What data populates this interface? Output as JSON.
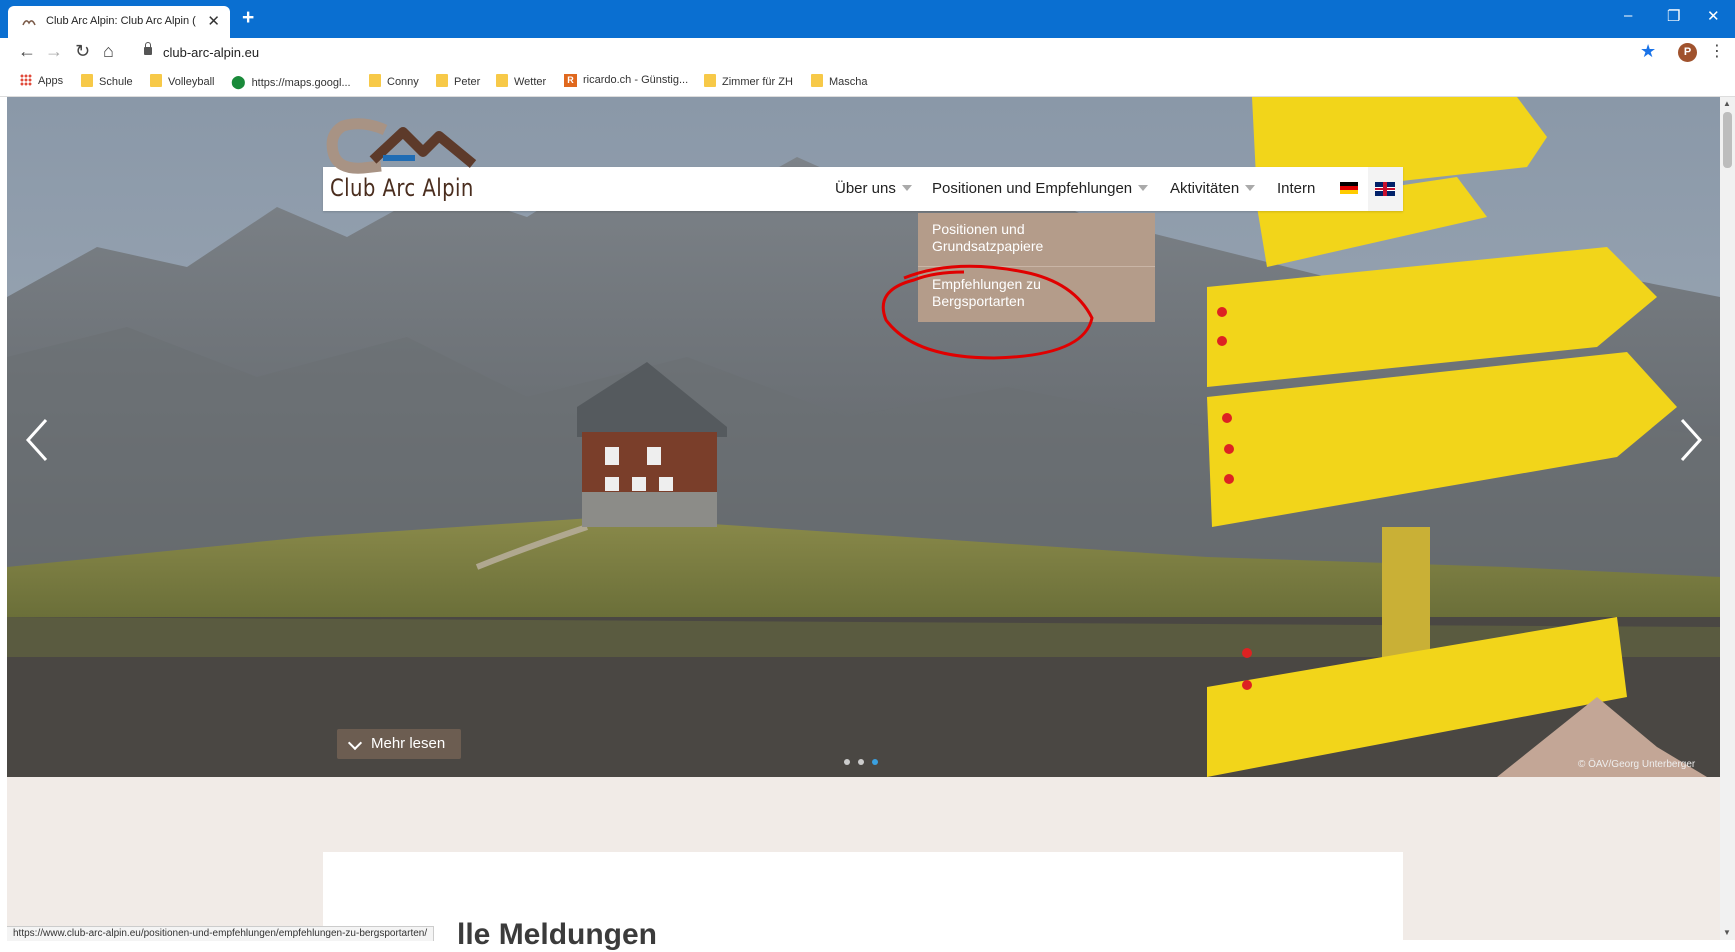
{
  "browser": {
    "tab_title": "Club Arc Alpin: Club Arc Alpin (C",
    "url": "club-arc-alpin.eu",
    "avatar_letter": "P",
    "bookmarks": [
      {
        "label": "Apps",
        "icon": "apps-icon"
      },
      {
        "label": "Schule",
        "icon": "folder-icon"
      },
      {
        "label": "Volleyball",
        "icon": "folder-icon"
      },
      {
        "label": "https://maps.googl...",
        "icon": "maps-pin-icon"
      },
      {
        "label": "Conny",
        "icon": "folder-icon"
      },
      {
        "label": "Peter",
        "icon": "folder-icon"
      },
      {
        "label": "Wetter",
        "icon": "folder-icon"
      },
      {
        "label": "ricardo.ch - Günstig...",
        "icon": "ricardo-icon",
        "icon_letter": "R"
      },
      {
        "label": "Zimmer für ZH",
        "icon": "folder-icon"
      },
      {
        "label": "Mascha",
        "icon": "folder-icon"
      }
    ],
    "status_url": "https://www.club-arc-alpin.eu/positionen-und-empfehlungen/empfehlungen-zu-bergsportarten/",
    "accent_color": "#0a6fd1"
  },
  "site": {
    "logo_text": "Club Arc Alpin",
    "nav": {
      "ueber_uns": "Über uns",
      "positionen": "Positionen und Empfehlungen",
      "aktivitaeten": "Aktivitäten",
      "intern": "Intern"
    },
    "dropdown": {
      "item1_line1": "Positionen und",
      "item1_line2": "Grundsatzpapiere",
      "item2_line1": "Empfehlungen zu",
      "item2_line2": "Bergsportarten"
    },
    "hero": {
      "mehr_lesen": "Mehr lesen",
      "credit": "© ÖAV/Georg Unterberger",
      "slides": 3,
      "active_slide": 3
    },
    "section_heading": "lle Meldungen",
    "dropdown_color": "#b49c8a",
    "highlight_color": "#e00000"
  }
}
